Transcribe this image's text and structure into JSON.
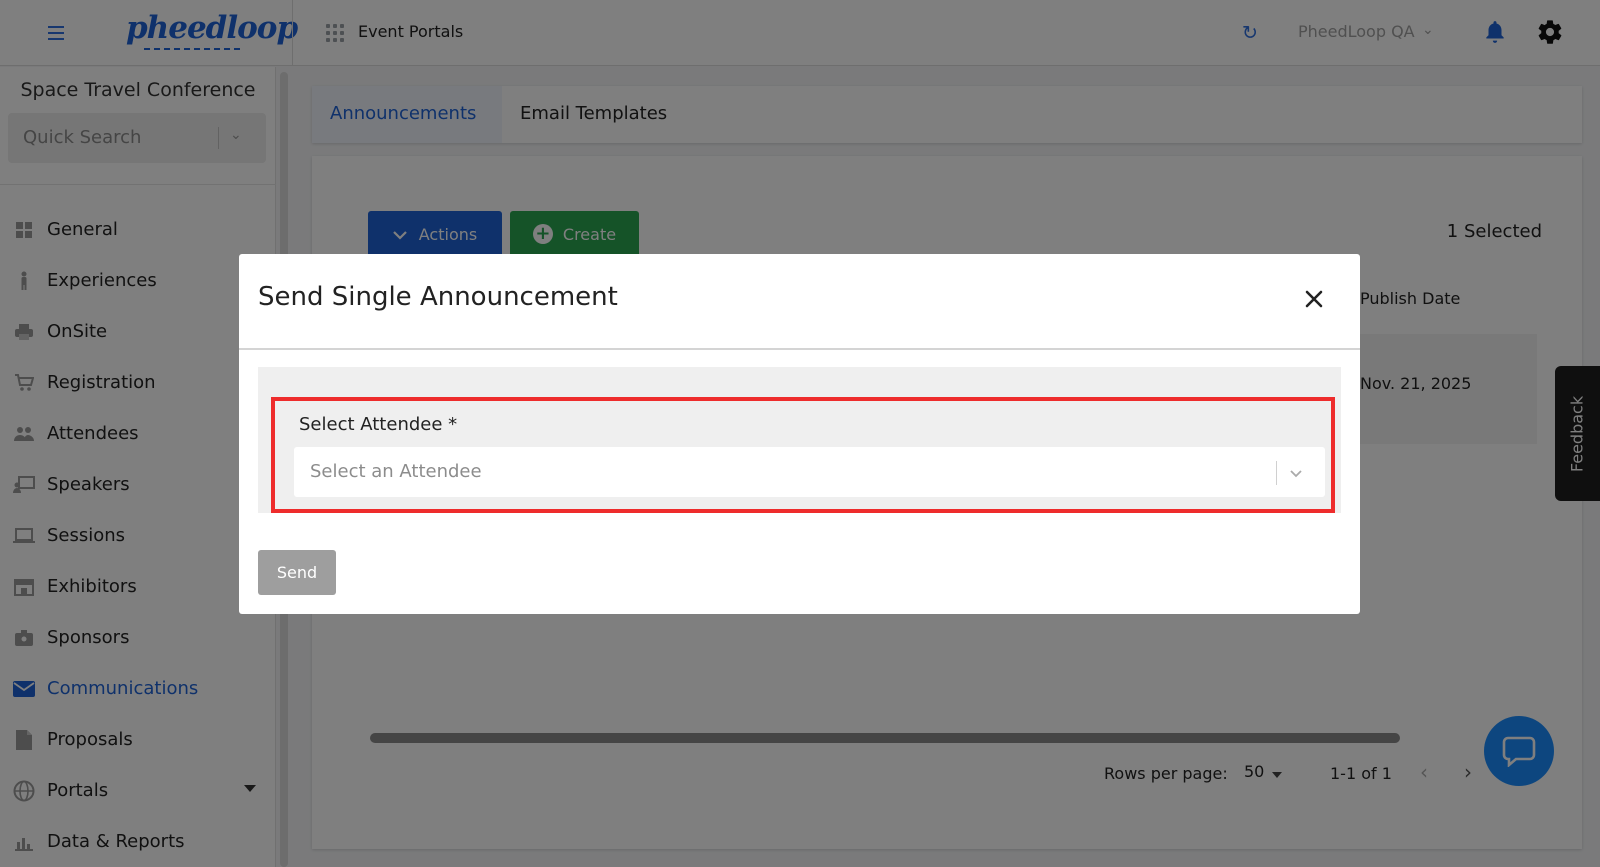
{
  "topbar": {
    "logo_text": "pheedloop",
    "app_section": "Event Portals",
    "org_name": "PheedLoop QA",
    "colors": {
      "brand": "#1e63d6"
    }
  },
  "sidebar": {
    "event_name": "Space Travel Conference",
    "quick_search_placeholder": "Quick Search",
    "items": [
      {
        "label": "General",
        "icon": "grid-icon"
      },
      {
        "label": "Experiences",
        "icon": "person-icon"
      },
      {
        "label": "OnSite",
        "icon": "printer-icon"
      },
      {
        "label": "Registration",
        "icon": "cart-icon"
      },
      {
        "label": "Attendees",
        "icon": "people-icon"
      },
      {
        "label": "Speakers",
        "icon": "presenter-icon"
      },
      {
        "label": "Sessions",
        "icon": "laptop-icon"
      },
      {
        "label": "Exhibitors",
        "icon": "storefront-icon"
      },
      {
        "label": "Sponsors",
        "icon": "badge-icon"
      },
      {
        "label": "Communications",
        "icon": "envelope-icon",
        "active": true
      },
      {
        "label": "Proposals",
        "icon": "document-icon"
      },
      {
        "label": "Portals",
        "icon": "globe-icon",
        "has_dropdown": true
      },
      {
        "label": "Data & Reports",
        "icon": "bar-chart-icon"
      }
    ]
  },
  "main": {
    "tabs": [
      {
        "label": "Announcements",
        "active": true
      },
      {
        "label": "Email Templates"
      }
    ],
    "actions_label": "Actions",
    "create_label": "Create",
    "selected_text": "1 Selected",
    "table": {
      "columns": [
        "Publish Date"
      ],
      "rows": [
        [
          "Nov. 21, 2025"
        ]
      ]
    },
    "pagination": {
      "rows_per_page_label": "Rows per page:",
      "rows_per_page": "50",
      "range": "1-1 of 1"
    }
  },
  "feedback_label": "Feedback",
  "modal": {
    "title": "Send Single Announcement",
    "field_label": "Select Attendee *",
    "field_placeholder": "Select an Attendee",
    "send_label": "Send"
  }
}
